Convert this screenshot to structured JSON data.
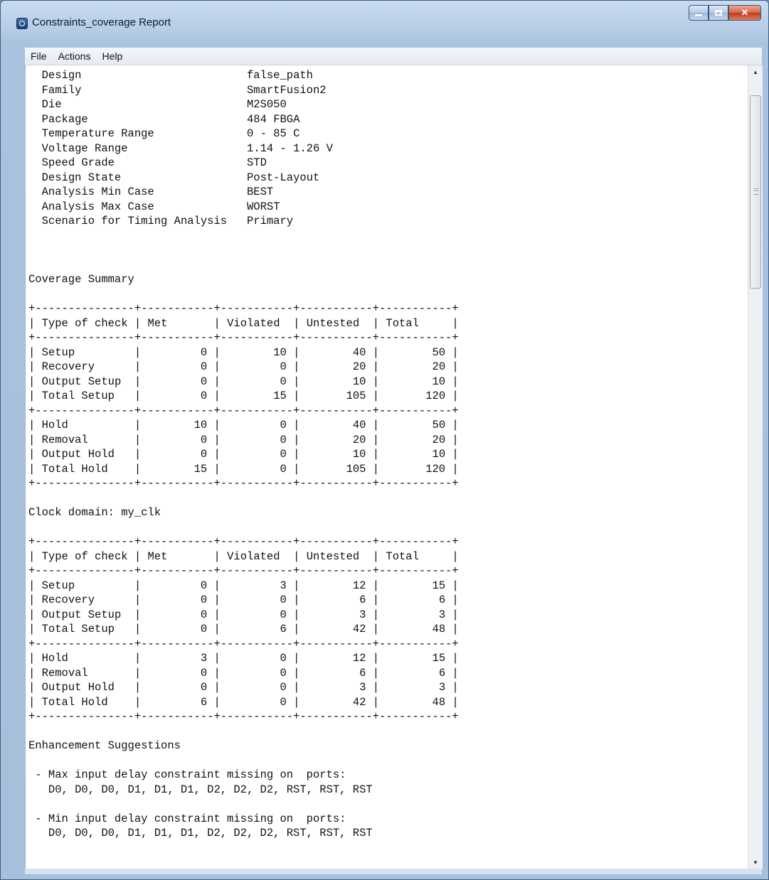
{
  "window": {
    "title": "Constraints_coverage Report",
    "minimize_icon": "minimize-icon",
    "maximize_icon": "maximize-icon",
    "close_icon": "close-icon"
  },
  "menu": {
    "file": "File",
    "actions": "Actions",
    "help": "Help"
  },
  "report": {
    "header": [
      {
        "label": "Design",
        "value": "false_path"
      },
      {
        "label": "Family",
        "value": "SmartFusion2"
      },
      {
        "label": "Die",
        "value": "M2S050"
      },
      {
        "label": "Package",
        "value": "484 FBGA"
      },
      {
        "label": "Temperature Range",
        "value": "0 - 85 C"
      },
      {
        "label": "Voltage Range",
        "value": "1.14 - 1.26 V"
      },
      {
        "label": "Speed Grade",
        "value": "STD"
      },
      {
        "label": "Design State",
        "value": "Post-Layout"
      },
      {
        "label": "Analysis Min Case",
        "value": "BEST"
      },
      {
        "label": "Analysis Max Case",
        "value": "WORST"
      },
      {
        "label": "Scenario for Timing Analysis",
        "value": "Primary"
      }
    ],
    "columns": [
      "Type of check",
      "Met",
      "Violated",
      "Untested",
      "Total"
    ],
    "sections": [
      {
        "title": "Coverage Summary",
        "groups": [
          [
            [
              "Setup",
              "0",
              "10",
              "40",
              "50"
            ],
            [
              "Recovery",
              "0",
              "0",
              "20",
              "20"
            ],
            [
              "Output Setup",
              "0",
              "0",
              "10",
              "10"
            ],
            [
              "Total Setup",
              "0",
              "15",
              "105",
              "120"
            ]
          ],
          [
            [
              "Hold",
              "10",
              "0",
              "40",
              "50"
            ],
            [
              "Removal",
              "0",
              "0",
              "20",
              "20"
            ],
            [
              "Output Hold",
              "0",
              "0",
              "10",
              "10"
            ],
            [
              "Total Hold",
              "15",
              "0",
              "105",
              "120"
            ]
          ]
        ]
      },
      {
        "title": "Clock domain: my_clk",
        "groups": [
          [
            [
              "Setup",
              "0",
              "3",
              "12",
              "15"
            ],
            [
              "Recovery",
              "0",
              "0",
              "6",
              "6"
            ],
            [
              "Output Setup",
              "0",
              "0",
              "3",
              "3"
            ],
            [
              "Total Setup",
              "0",
              "6",
              "42",
              "48"
            ]
          ],
          [
            [
              "Hold",
              "3",
              "0",
              "12",
              "15"
            ],
            [
              "Removal",
              "0",
              "0",
              "6",
              "6"
            ],
            [
              "Output Hold",
              "0",
              "0",
              "3",
              "3"
            ],
            [
              "Total Hold",
              "6",
              "0",
              "42",
              "48"
            ]
          ]
        ]
      }
    ],
    "suggestions_title": "Enhancement Suggestions",
    "suggestions": [
      {
        "text": "- Max input delay constraint missing on  ports:",
        "ports": "D0, D0, D0, D1, D1, D1, D2, D2, D2, RST, RST, RST"
      },
      {
        "text": "- Min input delay constraint missing on  ports:",
        "ports": "D0, D0, D0, D1, D1, D1, D2, D2, D2, RST, RST, RST"
      }
    ]
  }
}
